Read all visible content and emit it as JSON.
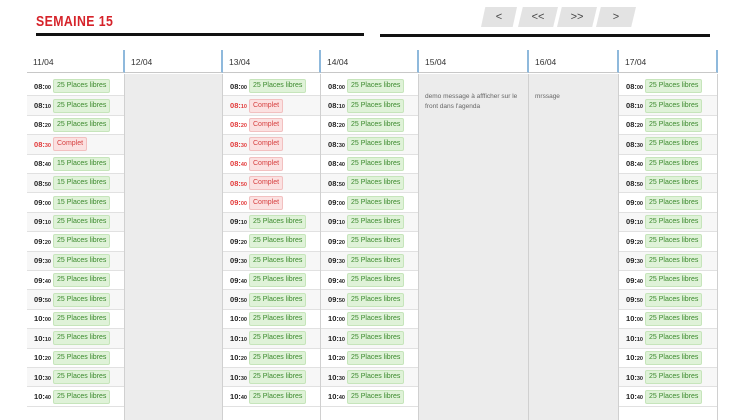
{
  "page": {
    "title": "SEMAINE 15"
  },
  "nav": {
    "prev": "<",
    "prev_fast": "<<",
    "next_fast": ">>",
    "next": ">"
  },
  "colors": {
    "accent": "#d6232a",
    "available": "#3c8a2e",
    "full": "#d64040",
    "header_line": "#8fb9dc"
  },
  "days": [
    {
      "label": "11/04",
      "type": "slots",
      "slots": [
        {
          "h": "08",
          "m": "00",
          "s": "25 Places libres",
          "full": false
        },
        {
          "h": "08",
          "m": "10",
          "s": "25 Places libres",
          "full": false
        },
        {
          "h": "08",
          "m": "20",
          "s": "25 Places libres",
          "full": false
        },
        {
          "h": "08",
          "m": "30",
          "s": "Complet",
          "full": true
        },
        {
          "h": "08",
          "m": "40",
          "s": "15 Places libres",
          "full": false
        },
        {
          "h": "08",
          "m": "50",
          "s": "15 Places libres",
          "full": false
        },
        {
          "h": "09",
          "m": "00",
          "s": "15 Places libres",
          "full": false
        },
        {
          "h": "09",
          "m": "10",
          "s": "25 Places libres",
          "full": false
        },
        {
          "h": "09",
          "m": "20",
          "s": "25 Places libres",
          "full": false
        },
        {
          "h": "09",
          "m": "30",
          "s": "25 Places libres",
          "full": false
        },
        {
          "h": "09",
          "m": "40",
          "s": "25 Places libres",
          "full": false
        },
        {
          "h": "09",
          "m": "50",
          "s": "25 Places libres",
          "full": false
        },
        {
          "h": "10",
          "m": "00",
          "s": "25 Places libres",
          "full": false
        },
        {
          "h": "10",
          "m": "10",
          "s": "25 Places libres",
          "full": false
        },
        {
          "h": "10",
          "m": "20",
          "s": "25 Places libres",
          "full": false
        },
        {
          "h": "10",
          "m": "30",
          "s": "25 Places libres",
          "full": false
        },
        {
          "h": "10",
          "m": "40",
          "s": "25 Places libres",
          "full": false
        }
      ]
    },
    {
      "label": "12/04",
      "type": "empty"
    },
    {
      "label": "13/04",
      "type": "slots",
      "slots": [
        {
          "h": "08",
          "m": "00",
          "s": "25 Places libres",
          "full": false
        },
        {
          "h": "08",
          "m": "10",
          "s": "Complet",
          "full": true
        },
        {
          "h": "08",
          "m": "20",
          "s": "Complet",
          "full": true
        },
        {
          "h": "08",
          "m": "30",
          "s": "Complet",
          "full": true
        },
        {
          "h": "08",
          "m": "40",
          "s": "Complet",
          "full": true
        },
        {
          "h": "08",
          "m": "50",
          "s": "Complet",
          "full": true
        },
        {
          "h": "09",
          "m": "00",
          "s": "Complet",
          "full": true
        },
        {
          "h": "09",
          "m": "10",
          "s": "25 Places libres",
          "full": false
        },
        {
          "h": "09",
          "m": "20",
          "s": "25 Places libres",
          "full": false
        },
        {
          "h": "09",
          "m": "30",
          "s": "25 Places libres",
          "full": false
        },
        {
          "h": "09",
          "m": "40",
          "s": "25 Places libres",
          "full": false
        },
        {
          "h": "09",
          "m": "50",
          "s": "25 Places libres",
          "full": false
        },
        {
          "h": "10",
          "m": "00",
          "s": "25 Places libres",
          "full": false
        },
        {
          "h": "10",
          "m": "10",
          "s": "25 Places libres",
          "full": false
        },
        {
          "h": "10",
          "m": "20",
          "s": "25 Places libres",
          "full": false
        },
        {
          "h": "10",
          "m": "30",
          "s": "25 Places libres",
          "full": false
        },
        {
          "h": "10",
          "m": "40",
          "s": "25 Places libres",
          "full": false
        }
      ]
    },
    {
      "label": "14/04",
      "type": "slots",
      "slots": [
        {
          "h": "08",
          "m": "00",
          "s": "25 Places libres",
          "full": false
        },
        {
          "h": "08",
          "m": "10",
          "s": "25 Places libres",
          "full": false
        },
        {
          "h": "08",
          "m": "20",
          "s": "25 Places libres",
          "full": false
        },
        {
          "h": "08",
          "m": "30",
          "s": "25 Places libres",
          "full": false
        },
        {
          "h": "08",
          "m": "40",
          "s": "25 Places libres",
          "full": false
        },
        {
          "h": "08",
          "m": "50",
          "s": "25 Places libres",
          "full": false
        },
        {
          "h": "09",
          "m": "00",
          "s": "25 Places libres",
          "full": false
        },
        {
          "h": "09",
          "m": "10",
          "s": "25 Places libres",
          "full": false
        },
        {
          "h": "09",
          "m": "20",
          "s": "25 Places libres",
          "full": false
        },
        {
          "h": "09",
          "m": "30",
          "s": "25 Places libres",
          "full": false
        },
        {
          "h": "09",
          "m": "40",
          "s": "25 Places libres",
          "full": false
        },
        {
          "h": "09",
          "m": "50",
          "s": "25 Places libres",
          "full": false
        },
        {
          "h": "10",
          "m": "00",
          "s": "25 Places libres",
          "full": false
        },
        {
          "h": "10",
          "m": "10",
          "s": "25 Places libres",
          "full": false
        },
        {
          "h": "10",
          "m": "20",
          "s": "25 Places libres",
          "full": false
        },
        {
          "h": "10",
          "m": "30",
          "s": "25 Places libres",
          "full": false
        },
        {
          "h": "10",
          "m": "40",
          "s": "25 Places libres",
          "full": false
        }
      ]
    },
    {
      "label": "15/04",
      "type": "message",
      "message": "demo message à affficher sur le front dans l'agenda"
    },
    {
      "label": "16/04",
      "type": "message",
      "message": "mrssage"
    },
    {
      "label": "17/04",
      "type": "slots",
      "slots": [
        {
          "h": "08",
          "m": "00",
          "s": "25 Places libres",
          "full": false
        },
        {
          "h": "08",
          "m": "10",
          "s": "25 Places libres",
          "full": false
        },
        {
          "h": "08",
          "m": "20",
          "s": "25 Places libres",
          "full": false
        },
        {
          "h": "08",
          "m": "30",
          "s": "25 Places libres",
          "full": false
        },
        {
          "h": "08",
          "m": "40",
          "s": "25 Places libres",
          "full": false
        },
        {
          "h": "08",
          "m": "50",
          "s": "25 Places libres",
          "full": false
        },
        {
          "h": "09",
          "m": "00",
          "s": "25 Places libres",
          "full": false
        },
        {
          "h": "09",
          "m": "10",
          "s": "25 Places libres",
          "full": false
        },
        {
          "h": "09",
          "m": "20",
          "s": "25 Places libres",
          "full": false
        },
        {
          "h": "09",
          "m": "30",
          "s": "25 Places libres",
          "full": false
        },
        {
          "h": "09",
          "m": "40",
          "s": "25 Places libres",
          "full": false
        },
        {
          "h": "09",
          "m": "50",
          "s": "25 Places libres",
          "full": false
        },
        {
          "h": "10",
          "m": "00",
          "s": "25 Places libres",
          "full": false
        },
        {
          "h": "10",
          "m": "10",
          "s": "25 Places libres",
          "full": false
        },
        {
          "h": "10",
          "m": "20",
          "s": "25 Places libres",
          "full": false
        },
        {
          "h": "10",
          "m": "30",
          "s": "25 Places libres",
          "full": false
        },
        {
          "h": "10",
          "m": "40",
          "s": "25 Places libres",
          "full": false
        }
      ]
    }
  ]
}
